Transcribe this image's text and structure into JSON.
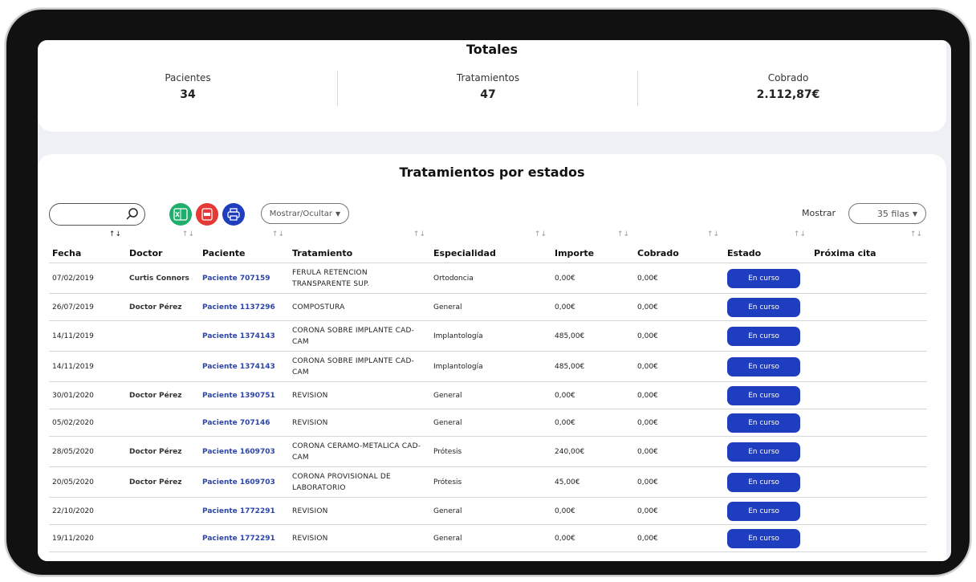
{
  "totals": {
    "title": "Totales",
    "stats": [
      {
        "label": "Pacientes",
        "value": "34"
      },
      {
        "label": "Tratamientos",
        "value": "47"
      },
      {
        "label": "Cobrado",
        "value": "2.112,87€"
      }
    ]
  },
  "section": {
    "title": "Tratamientos por estados",
    "toggle_columns_label": "Mostrar/Ocultar",
    "show_label": "Mostrar",
    "rows_select_value": "35 filas"
  },
  "table": {
    "columns": [
      "Fecha",
      "Doctor",
      "Paciente",
      "Tratamiento",
      "Especialidad",
      "Importe",
      "Cobrado",
      "Estado",
      "Próxima cita"
    ],
    "rows": [
      {
        "fecha": "07/02/2019",
        "doctor": "Curtis Connors",
        "paciente": "Paciente 707159",
        "tratamiento": "FERULA RETENCION TRANSPARENTE SUP.",
        "especialidad": "Ortodoncia",
        "importe": "0,00€",
        "cobrado": "0,00€",
        "estado": "En curso",
        "proxima": ""
      },
      {
        "fecha": "26/07/2019",
        "doctor": "Doctor Pérez",
        "paciente": "Paciente 1137296",
        "tratamiento": "COMPOSTURA",
        "especialidad": "General",
        "importe": "0,00€",
        "cobrado": "0,00€",
        "estado": "En curso",
        "proxima": ""
      },
      {
        "fecha": "14/11/2019",
        "doctor": "",
        "paciente": "Paciente 1374143",
        "tratamiento": "CORONA SOBRE IMPLANTE CAD-CAM",
        "especialidad": "Implantología",
        "importe": "485,00€",
        "cobrado": "0,00€",
        "estado": "En curso",
        "proxima": ""
      },
      {
        "fecha": "14/11/2019",
        "doctor": "",
        "paciente": "Paciente 1374143",
        "tratamiento": "CORONA SOBRE IMPLANTE CAD-CAM",
        "especialidad": "Implantología",
        "importe": "485,00€",
        "cobrado": "0,00€",
        "estado": "En curso",
        "proxima": ""
      },
      {
        "fecha": "30/01/2020",
        "doctor": "Doctor Pérez",
        "paciente": "Paciente 1390751",
        "tratamiento": "REVISION",
        "especialidad": "General",
        "importe": "0,00€",
        "cobrado": "0,00€",
        "estado": "En curso",
        "proxima": ""
      },
      {
        "fecha": "05/02/2020",
        "doctor": "",
        "paciente": "Paciente 707146",
        "tratamiento": "REVISION",
        "especialidad": "General",
        "importe": "0,00€",
        "cobrado": "0,00€",
        "estado": "En curso",
        "proxima": ""
      },
      {
        "fecha": "28/05/2020",
        "doctor": "Doctor Pérez",
        "paciente": "Paciente 1609703",
        "tratamiento": "CORONA CERAMO-METALICA CAD-CAM",
        "especialidad": "Prótesis",
        "importe": "240,00€",
        "cobrado": "0,00€",
        "estado": "En curso",
        "proxima": ""
      },
      {
        "fecha": "20/05/2020",
        "doctor": "Doctor Pérez",
        "paciente": "Paciente 1609703",
        "tratamiento": "CORONA PROVISIONAL DE LABORATORIO",
        "especialidad": "Prótesis",
        "importe": "45,00€",
        "cobrado": "0,00€",
        "estado": "En curso",
        "proxima": ""
      },
      {
        "fecha": "22/10/2020",
        "doctor": "",
        "paciente": "Paciente 1772291",
        "tratamiento": "REVISION",
        "especialidad": "General",
        "importe": "0,00€",
        "cobrado": "0,00€",
        "estado": "En curso",
        "proxima": ""
      },
      {
        "fecha": "19/11/2020",
        "doctor": "",
        "paciente": "Paciente 1772291",
        "tratamiento": "REVISION",
        "especialidad": "General",
        "importe": "0,00€",
        "cobrado": "0,00€",
        "estado": "En curso",
        "proxima": ""
      }
    ]
  },
  "colors": {
    "accent": "#1f3dbf",
    "excel": "#1fae6b",
    "pdf": "#e53935",
    "print": "#1f3dbf",
    "link": "#2b45a8"
  },
  "icons": {
    "search": "search-icon",
    "excel": "excel-icon",
    "pdf": "pdf-icon",
    "print": "print-icon",
    "sort": "sort-icon"
  }
}
